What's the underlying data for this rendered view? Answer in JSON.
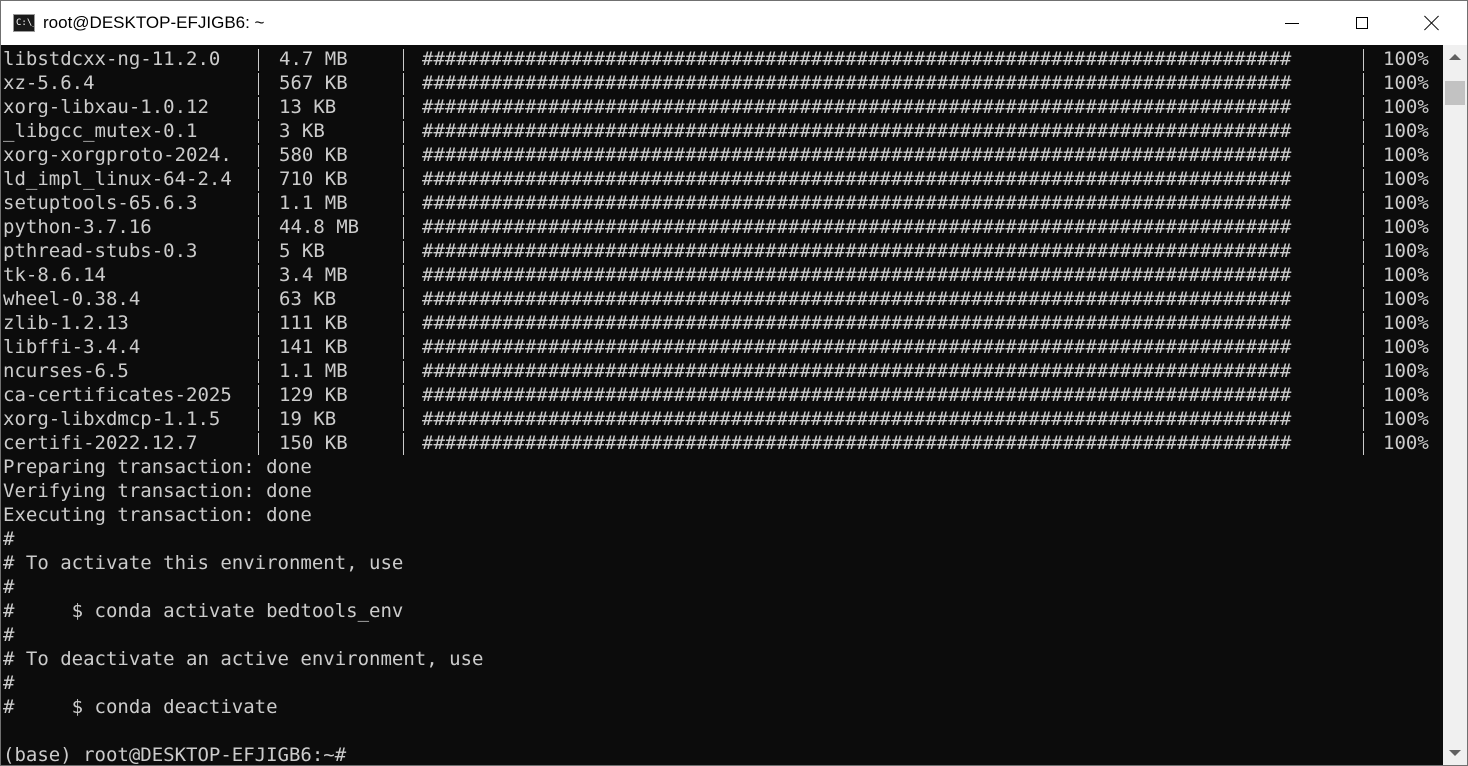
{
  "window": {
    "title": "root@DESKTOP-EFJIGB6: ~",
    "app_icon_text": "C:\\_"
  },
  "packages": [
    {
      "name": "libstdcxx-ng-11.2.0",
      "size": "4.7 MB",
      "progress": "100%"
    },
    {
      "name": "xz-5.6.4",
      "size": "567 KB",
      "progress": "100%"
    },
    {
      "name": "xorg-libxau-1.0.12",
      "size": "13 KB",
      "progress": "100%"
    },
    {
      "name": "_libgcc_mutex-0.1",
      "size": "3 KB",
      "progress": "100%"
    },
    {
      "name": "xorg-xorgproto-2024.",
      "size": "580 KB",
      "progress": "100%"
    },
    {
      "name": "ld_impl_linux-64-2.4",
      "size": "710 KB",
      "progress": "100%"
    },
    {
      "name": "setuptools-65.6.3",
      "size": "1.1 MB",
      "progress": "100%"
    },
    {
      "name": "python-3.7.16",
      "size": "44.8 MB",
      "progress": "100%"
    },
    {
      "name": "pthread-stubs-0.3",
      "size": "5 KB",
      "progress": "100%"
    },
    {
      "name": "tk-8.6.14",
      "size": "3.4 MB",
      "progress": "100%"
    },
    {
      "name": "wheel-0.38.4",
      "size": "63 KB",
      "progress": "100%"
    },
    {
      "name": "zlib-1.2.13",
      "size": "111 KB",
      "progress": "100%"
    },
    {
      "name": "libffi-3.4.4",
      "size": "141 KB",
      "progress": "100%"
    },
    {
      "name": "ncurses-6.5",
      "size": "1.1 MB",
      "progress": "100%"
    },
    {
      "name": "ca-certificates-2025",
      "size": "129 KB",
      "progress": "100%"
    },
    {
      "name": "xorg-libxdmcp-1.1.5",
      "size": "19 KB",
      "progress": "100%"
    },
    {
      "name": "certifi-2022.12.7",
      "size": "150 KB",
      "progress": "100%"
    }
  ],
  "progress_bar": "############################################################################",
  "output_lines": [
    "Preparing transaction: done",
    "Verifying transaction: done",
    "Executing transaction: done",
    "#",
    "# To activate this environment, use",
    "#",
    "#     $ conda activate bedtools_env",
    "#",
    "# To deactivate an active environment, use",
    "#",
    "#     $ conda deactivate",
    "",
    "(base) root@DESKTOP-EFJIGB6:~#"
  ],
  "colors": {
    "console_bg": "#0c0c0c",
    "console_fg": "#cccccc",
    "titlebar_bg": "#ffffff",
    "scrollbar_bg": "#f0f0f0"
  }
}
